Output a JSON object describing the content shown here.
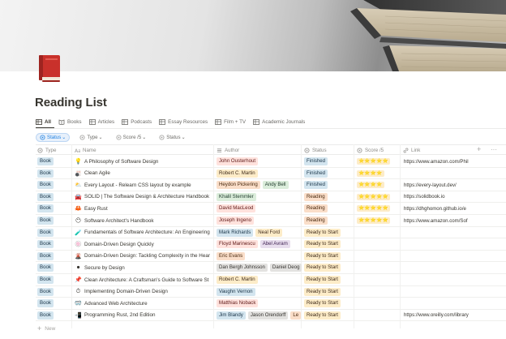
{
  "page": {
    "title": "Reading List",
    "icon": "red-book-icon"
  },
  "views": [
    {
      "label": "All",
      "icon": "table-icon",
      "active": true
    },
    {
      "label": "Books",
      "icon": "book-icon"
    },
    {
      "label": "Articles",
      "icon": "table-icon"
    },
    {
      "label": "Podcasts",
      "icon": "table-icon"
    },
    {
      "label": "Essay Resources",
      "icon": "table-icon"
    },
    {
      "label": "Film + TV",
      "icon": "table-icon"
    },
    {
      "label": "Academic Journals",
      "icon": "table-icon"
    }
  ],
  "filters": [
    {
      "label": "Status",
      "active": true
    },
    {
      "label": "Type"
    },
    {
      "label": "Score /5"
    },
    {
      "label": "Status"
    }
  ],
  "columns": {
    "type": "Type",
    "name": "Name",
    "author": "Author",
    "status": "Status",
    "score": "Score /5",
    "link": "Link"
  },
  "rows": [
    {
      "type": "Book",
      "icon": "💡",
      "name": "A Philosophy of Software Design",
      "authors": [
        {
          "n": "John Ousterhout",
          "c": "r"
        }
      ],
      "status": "Finished",
      "stars": "⭐⭐⭐⭐⭐",
      "link": "https://www.amazon.com/Phil"
    },
    {
      "type": "Book",
      "icon": "🎳",
      "name": "Clean Agile",
      "authors": [
        {
          "n": "Robert C. Martin",
          "c": "y"
        }
      ],
      "status": "Finished",
      "stars": "⭐⭐⭐⭐",
      "link": ""
    },
    {
      "type": "Book",
      "icon": "⛅",
      "name": "Every Layout - Relearn CSS layout by example",
      "authors": [
        {
          "n": "Heydon Pickering",
          "c": "o"
        },
        {
          "n": "Andy Bell",
          "c": "g"
        }
      ],
      "status": "Finished",
      "stars": "⭐⭐⭐⭐",
      "link": "https://every-layout.dev/"
    },
    {
      "type": "Book",
      "icon": "🚘",
      "name": "SOLID | The Software Design & Architecture Handbook",
      "authors": [
        {
          "n": "Khalil Stemmler",
          "c": "g"
        }
      ],
      "status": "Reading",
      "stars": "⭐⭐⭐⭐⭐",
      "link": "https://solidbook.io"
    },
    {
      "type": "Book",
      "icon": "🦀",
      "name": "Easy Rust",
      "authors": [
        {
          "n": "David MacLeod",
          "c": "r"
        }
      ],
      "status": "Reading",
      "stars": "⭐⭐⭐⭐⭐",
      "link": "https://dhghomon.github.io/e"
    },
    {
      "type": "Book",
      "icon": "😶",
      "name": "Software Architect's Handbook",
      "authors": [
        {
          "n": "Joseph Ingeno",
          "c": "r"
        }
      ],
      "status": "Reading",
      "stars": "⭐⭐⭐⭐⭐",
      "link": "https://www.amazon.com/Sof"
    },
    {
      "type": "Book",
      "icon": "🧪",
      "name": "Fundamentals of Software Architecture: An Engineering",
      "authors": [
        {
          "n": "Mark Richards",
          "c": "b"
        },
        {
          "n": "Neal Ford",
          "c": "y"
        }
      ],
      "status": "Ready to Start",
      "stars": "",
      "link": ""
    },
    {
      "type": "Book",
      "icon": "🍥",
      "name": "Domain-Driven Design Quickly",
      "authors": [
        {
          "n": "Floyd Marinescu",
          "c": "r"
        },
        {
          "n": "Abel Avram",
          "c": "p"
        }
      ],
      "status": "Ready to Start",
      "stars": "",
      "link": ""
    },
    {
      "type": "Book",
      "icon": "🌋",
      "name": "Domain-Driven Design: Tackling Complexity in the Hear",
      "authors": [
        {
          "n": "Eric Evans",
          "c": "o"
        }
      ],
      "status": "Ready to Start",
      "stars": "",
      "link": ""
    },
    {
      "type": "Book",
      "icon": "⚫",
      "name": "Secure by Design",
      "authors": [
        {
          "n": "Dan Bergh Johnsson",
          "c": "gr"
        },
        {
          "n": "Daniel Deog",
          "c": "gr"
        }
      ],
      "status": "Ready to Start",
      "stars": "",
      "link": ""
    },
    {
      "type": "Book",
      "icon": "📌",
      "name": "Clean Architecture: A Craftsman's Guide to Software St",
      "authors": [
        {
          "n": "Robert C. Martin",
          "c": "y"
        }
      ],
      "status": "Ready to Start",
      "stars": "",
      "link": ""
    },
    {
      "type": "Book",
      "icon": "⏱",
      "name": "Implementing Domain-Driven Design",
      "authors": [
        {
          "n": "Vaughn Vernon",
          "c": "b"
        }
      ],
      "status": "Ready to Start",
      "stars": "",
      "link": ""
    },
    {
      "type": "Book",
      "icon": "🥽",
      "name": "Advanced Web Architecture",
      "authors": [
        {
          "n": "Matthias Noback",
          "c": "r"
        }
      ],
      "status": "Ready to Start",
      "stars": "",
      "link": ""
    },
    {
      "type": "Book",
      "icon": "📲",
      "name": "Programming Rust, 2nd Edition",
      "authors": [
        {
          "n": "Jim Blandy",
          "c": "b"
        },
        {
          "n": "Jason Orendorff",
          "c": "gr"
        },
        {
          "n": "Le",
          "c": "o"
        }
      ],
      "status": "Ready to Start",
      "stars": "",
      "link": "https://www.oreilly.com/library"
    }
  ],
  "new_row_label": "New",
  "colors": {
    "accent": "#2383e2",
    "text": "#37352f",
    "muted": "#8b8a86"
  }
}
